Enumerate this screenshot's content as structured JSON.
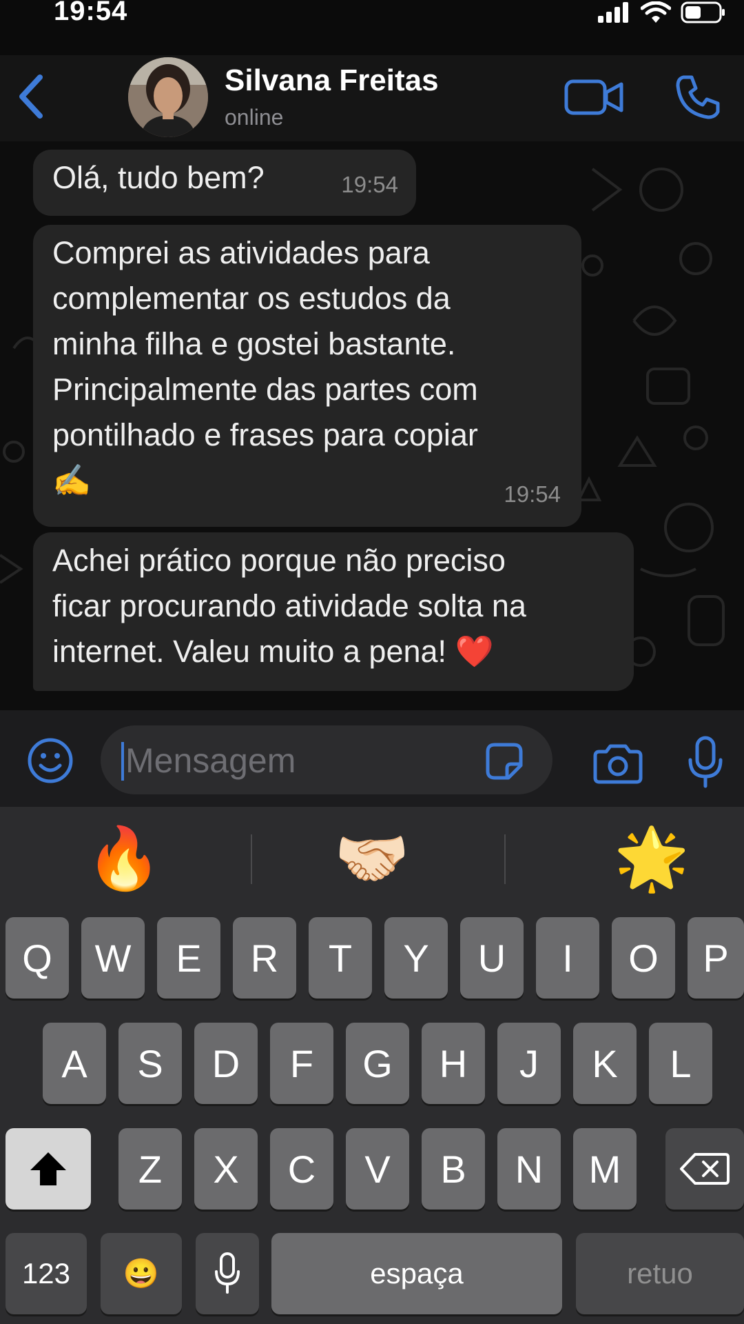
{
  "status_bar": {
    "time": "19:54"
  },
  "header": {
    "contact_name": "Silvana Freitas",
    "contact_status": "online"
  },
  "messages": [
    {
      "text": "Olá, tudo bem?",
      "time": "19:54"
    },
    {
      "text": "Comprei as atividades para\ncomplementar os estudos da\nminha filha e gostei bastante.\nPrincipalmente das partes com\npontilhado e frases para copiar\n✍️",
      "time": "19:54"
    },
    {
      "text": "Achei prático porque não preciso\nficar procurando atividade solta na\ninternet. Valeu muito a pena! ❤️"
    }
  ],
  "input": {
    "placeholder": "Mensagem"
  },
  "keyboard": {
    "suggestions": [
      "🔥",
      "🤝🏻",
      "🌟"
    ],
    "row1": [
      "Q",
      "W",
      "E",
      "R",
      "T",
      "Y",
      "U",
      "I",
      "O",
      "P"
    ],
    "row2": [
      "A",
      "S",
      "D",
      "F",
      "G",
      "H",
      "J",
      "K",
      "L"
    ],
    "row3": [
      "Z",
      "X",
      "C",
      "V",
      "B",
      "N",
      "M"
    ],
    "numbers_label": "123",
    "emoji_label": "😀",
    "space_label": "espaça",
    "return_label": "retuo"
  },
  "icons": [
    "back-chevron-icon",
    "video-call-icon",
    "phone-icon",
    "emoji-icon",
    "sticker-icon",
    "camera-icon",
    "microphone-icon",
    "shift-icon",
    "backspace-icon"
  ],
  "colors": {
    "accent": "#3e7bd8",
    "bubble": "#252525",
    "background": "#0d0d0d"
  }
}
